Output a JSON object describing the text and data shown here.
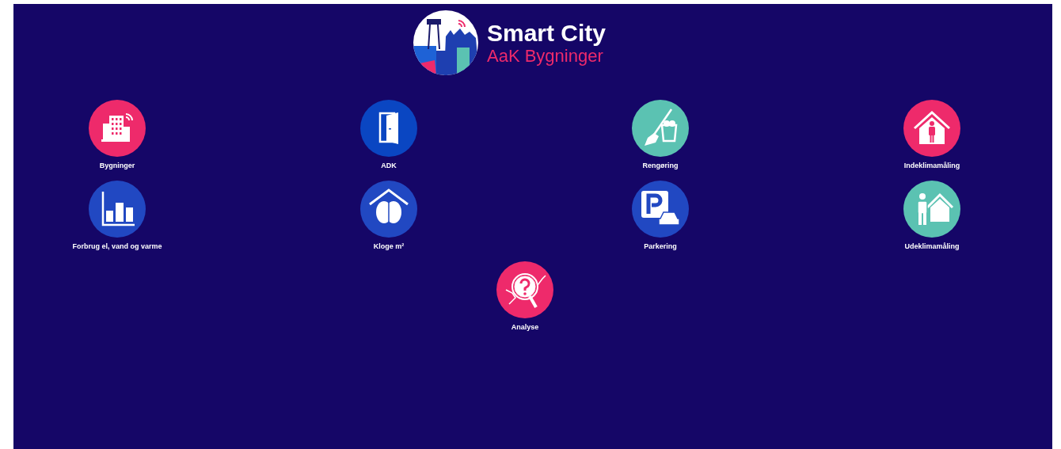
{
  "header": {
    "title": "Smart City",
    "subtitle": "AaK Bygninger"
  },
  "tiles": [
    {
      "label": "Bygninger",
      "kind": "buildings",
      "color": "#ee2a6b"
    },
    {
      "label": "ADK",
      "kind": "door",
      "color": "#0a46c2"
    },
    {
      "label": "Rengøring",
      "kind": "cleaning",
      "color": "#5bc2b2"
    },
    {
      "label": "Indeklimamåling",
      "kind": "indoor",
      "color": "#ee2a6b"
    },
    {
      "label": "Forbrug el, vand og varme",
      "kind": "chart",
      "color": "#2148c2"
    },
    {
      "label": "Kloge m²",
      "kind": "brain",
      "color": "#2148c2"
    },
    {
      "label": "Parkering",
      "kind": "parking",
      "color": "#2148c2"
    },
    {
      "label": "Udeklimamåling",
      "kind": "outdoor",
      "color": "#5bc2b2"
    },
    {
      "label": "Analyse",
      "kind": "analysis",
      "color": "#ee2a6b"
    }
  ]
}
